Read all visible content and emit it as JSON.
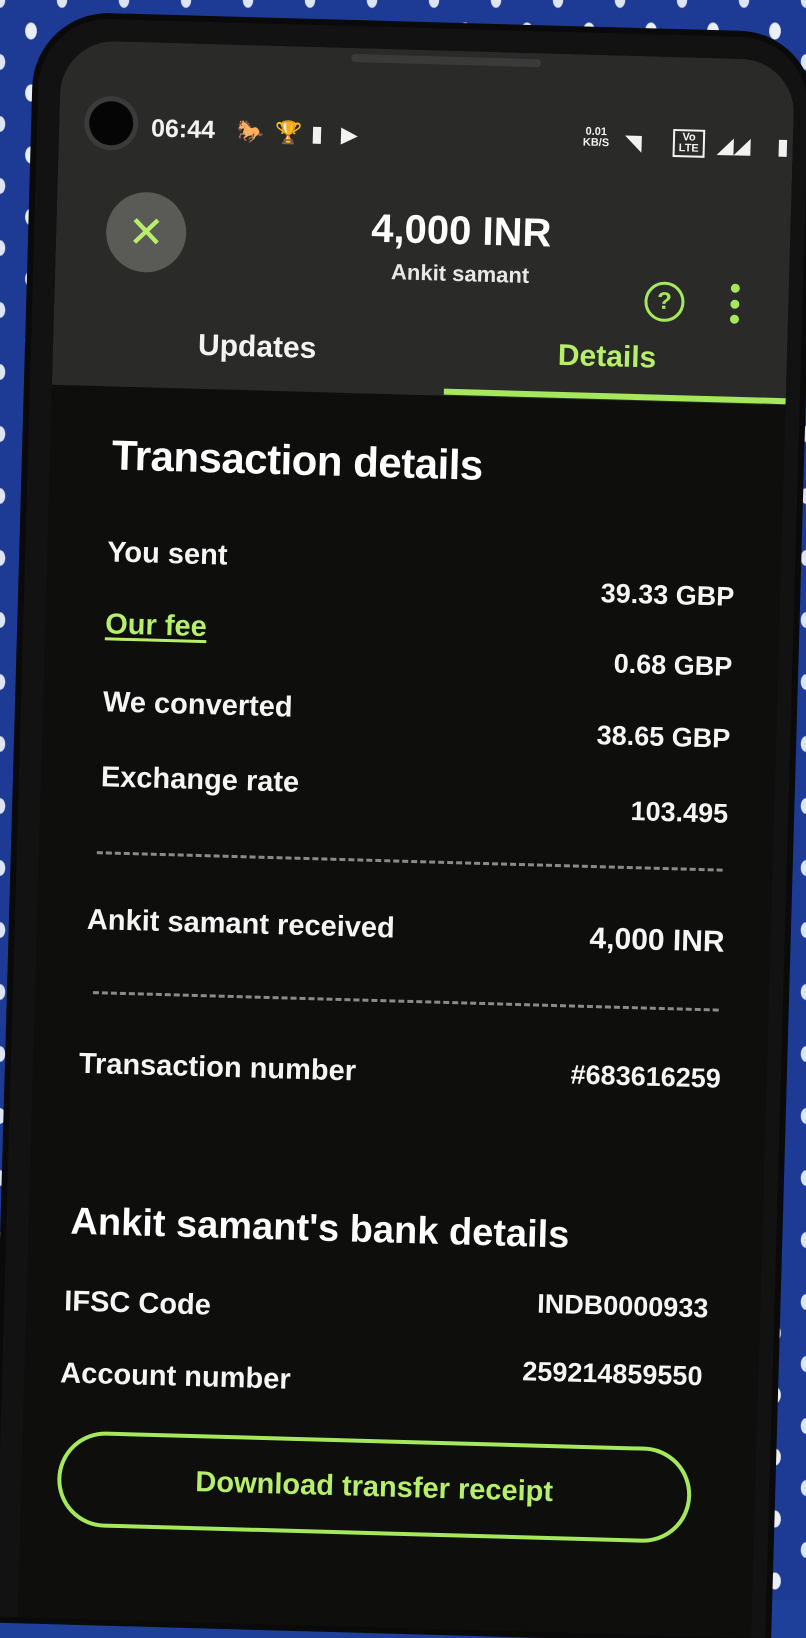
{
  "status_bar": {
    "time": "06:44",
    "net_speed_top": "0.01",
    "net_speed_bottom": "KB/S",
    "volte": "Vo LTE"
  },
  "header": {
    "amount": "4,000 INR",
    "recipient": "Ankit samant"
  },
  "tabs": [
    {
      "label": "Updates",
      "active": false
    },
    {
      "label": "Details",
      "active": true
    }
  ],
  "transaction": {
    "title": "Transaction details",
    "rows": [
      {
        "label": "You sent",
        "value": "39.33 GBP"
      },
      {
        "label": "Our fee",
        "value": "0.68 GBP"
      },
      {
        "label": "We converted",
        "value": "38.65 GBP"
      },
      {
        "label": "Exchange rate",
        "value": "103.495"
      }
    ],
    "received_label": "Ankit samant received",
    "received_value": "4,000 INR",
    "number_label": "Transaction number",
    "number_value": "#683616259"
  },
  "bank": {
    "title": "Ankit samant's bank details",
    "ifsc_label": "IFSC Code",
    "ifsc_value": "INDB0000933",
    "account_label": "Account number",
    "account_value": "259214859550"
  },
  "download_button": "Download transfer receipt",
  "colors": {
    "accent": "#a6e85b",
    "background": "#0e0f0d",
    "header_bg": "#2a2b28"
  }
}
